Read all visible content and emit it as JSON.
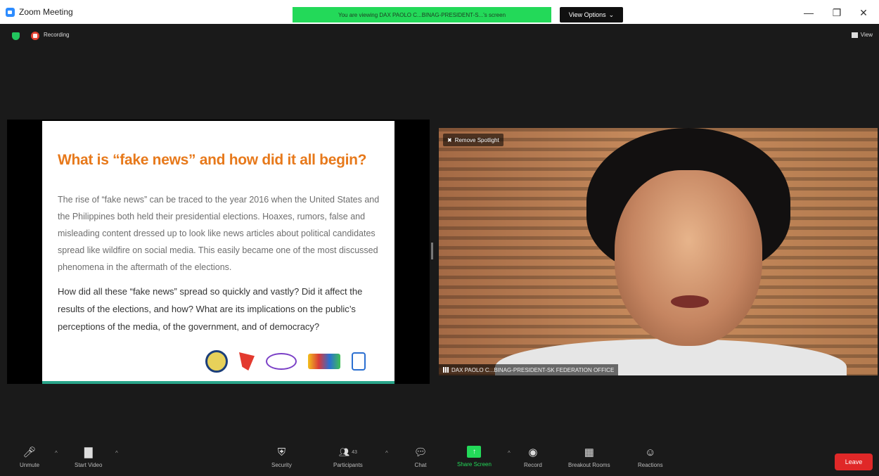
{
  "window": {
    "title": "Zoom Meeting",
    "share_banner": "You are viewing DAX PAOLO C...BINAG-PRESIDENT-S...'s screen",
    "view_options": "View Options",
    "minimize": "—",
    "restore": "❐",
    "close": "✕"
  },
  "status": {
    "recording_label": "Recording",
    "view_label": "View"
  },
  "slide": {
    "title": "What is “fake news” and how did it all begin?",
    "paragraph1": "The rise of “fake news” can be traced to the year 2016 when the United States and the Philippines both held their presidential elections. Hoaxes, rumors, false and misleading content dressed up to look like news articles about political candidates spread like wildfire on social media. This easily became one of the most discussed phenomena in the aftermath of the elections.",
    "paragraph2": "How did all these “fake news” spread so quickly and vastly? Did it affect the results of the elections, and how? What are its implications on the public’s perceptions of the media, of the government, and of democracy?"
  },
  "video": {
    "spotlight_label": "Remove Spotlight",
    "participant_name": "DAX PAOLO C...BINAG-PRESIDENT-SK FEDERATION OFFICE"
  },
  "toolbar": {
    "unmute": "Unmute",
    "start_video": "Start Video",
    "security": "Security",
    "participants": "Participants",
    "participant_count": "43",
    "chat": "Chat",
    "share_screen": "Share Screen",
    "record": "Record",
    "breakout_rooms": "Breakout Rooms",
    "reactions": "Reactions",
    "leave": "Leave"
  },
  "colors": {
    "accent_green": "#23d959",
    "leave_red": "#e02828",
    "slide_title_orange": "#e7791b"
  }
}
